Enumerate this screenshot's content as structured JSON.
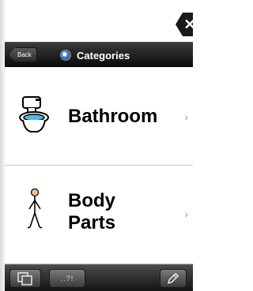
{
  "entry_bar": {
    "clear_symbol": "✕"
  },
  "nav": {
    "back_label": "Back",
    "title": "Categories"
  },
  "categories": [
    {
      "label": "Bathroom",
      "icon": "toilet-icon",
      "chevron": "›"
    },
    {
      "label": "Body Parts",
      "icon": "person-figure-icon",
      "chevron": "›"
    }
  ],
  "toolbar": {
    "copy_icon": "copy-icon",
    "punctuation_label": "..?!",
    "edit_icon": "pencil-icon"
  },
  "colors": {
    "nav_bar": "#1a1a1a",
    "toolbar": "#2c2c2c",
    "divider": "#c8c8c8",
    "chevron": "#9a9a9a"
  }
}
